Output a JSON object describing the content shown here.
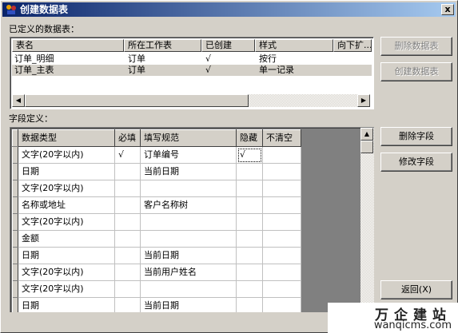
{
  "window": {
    "title": "创建数据表",
    "close_glyph": "x"
  },
  "tables_section": {
    "label": "已定义的数据表：",
    "columns": [
      "表名",
      "所在工作表",
      "已创建",
      "样式",
      "向下扩..."
    ],
    "rows": [
      {
        "name": "订单_明细",
        "sheet": "订单",
        "created": "√",
        "style": "按行",
        "expand": ""
      },
      {
        "name": "订单_主表",
        "sheet": "订单",
        "created": "√",
        "style": "单一记录",
        "expand": ""
      }
    ],
    "selected_row": 1,
    "delete_button": "删除数据表",
    "create_button": "创建数据表"
  },
  "fields_section": {
    "label": "字段定义：",
    "columns": [
      "数据类型",
      "必填",
      "填写规范",
      "隐藏",
      "不清空"
    ],
    "rows": [
      {
        "type": "文字(20字以内)",
        "required": "√",
        "rule": "订单编号",
        "hidden": "√",
        "keep": ""
      },
      {
        "type": "日期",
        "required": "",
        "rule": "当前日期",
        "hidden": "",
        "keep": ""
      },
      {
        "type": "文字(20字以内)",
        "required": "",
        "rule": "",
        "hidden": "",
        "keep": ""
      },
      {
        "type": "名称或地址",
        "required": "",
        "rule": "客户名称树",
        "hidden": "",
        "keep": ""
      },
      {
        "type": "文字(20字以内)",
        "required": "",
        "rule": "",
        "hidden": "",
        "keep": ""
      },
      {
        "type": "金额",
        "required": "",
        "rule": "",
        "hidden": "",
        "keep": ""
      },
      {
        "type": "日期",
        "required": "",
        "rule": "当前日期",
        "hidden": "",
        "keep": ""
      },
      {
        "type": "文字(20字以内)",
        "required": "",
        "rule": "当前用户姓名",
        "hidden": "",
        "keep": ""
      },
      {
        "type": "文字(20字以内)",
        "required": "",
        "rule": "",
        "hidden": "",
        "keep": ""
      },
      {
        "type": "日期",
        "required": "",
        "rule": "当前日期",
        "hidden": "",
        "keep": ""
      }
    ],
    "delete_button": "删除字段",
    "modify_button": "修改字段",
    "back_button": "返回(X)"
  },
  "watermark": {
    "cn": "万企建站",
    "url": "wanqicms.com"
  },
  "colors": {
    "title_start": "#0a246a",
    "title_end": "#a6caf0",
    "face": "#d4d0c8"
  }
}
